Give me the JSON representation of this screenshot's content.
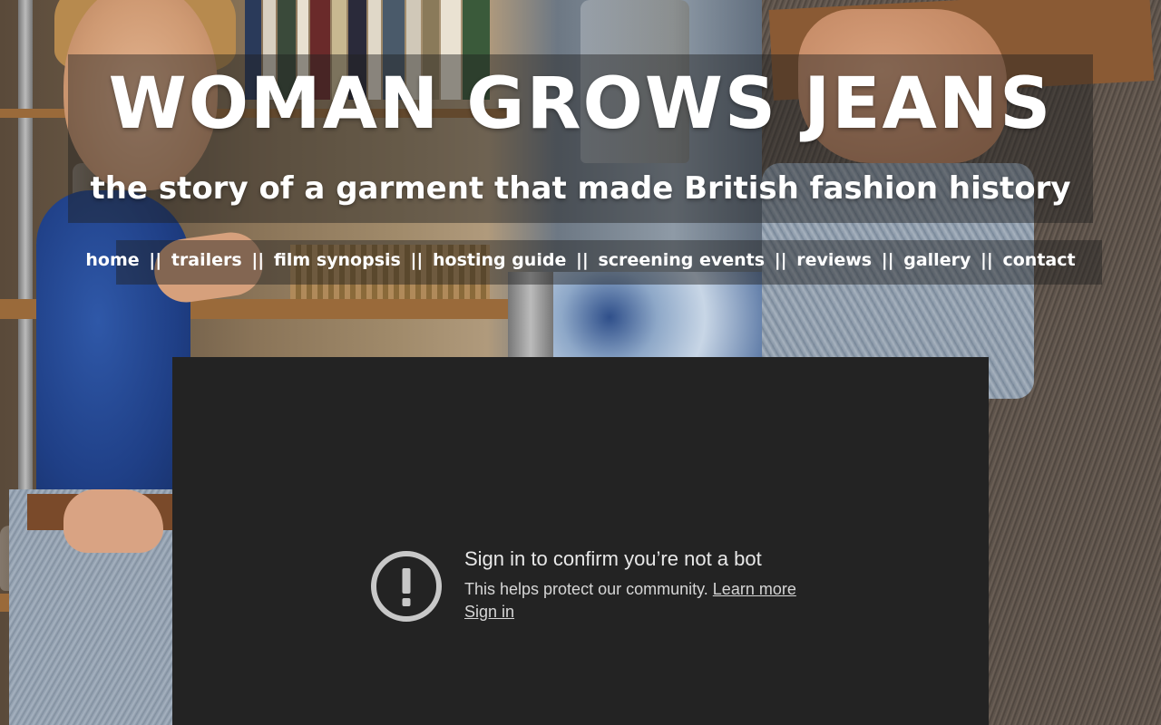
{
  "header": {
    "title": "WOMAN GROWS JEANS",
    "subtitle": "the story of a garment that made British fashion history"
  },
  "nav": {
    "separator": "||",
    "items": [
      {
        "label": "home"
      },
      {
        "label": "trailers"
      },
      {
        "label": "film synopsis"
      },
      {
        "label": "hosting guide"
      },
      {
        "label": "screening events"
      },
      {
        "label": "reviews"
      },
      {
        "label": "gallery"
      },
      {
        "label": "contact"
      }
    ]
  },
  "video": {
    "heading": "Sign in to confirm you’re not a bot",
    "description": "This helps protect our community.",
    "learn_more": "Learn more",
    "sign_in": "Sign in",
    "icon": "exclamation-circle-icon"
  },
  "colors": {
    "panel": "#1e1e1e",
    "player_bg": "#232323",
    "text": "#ffffff"
  }
}
